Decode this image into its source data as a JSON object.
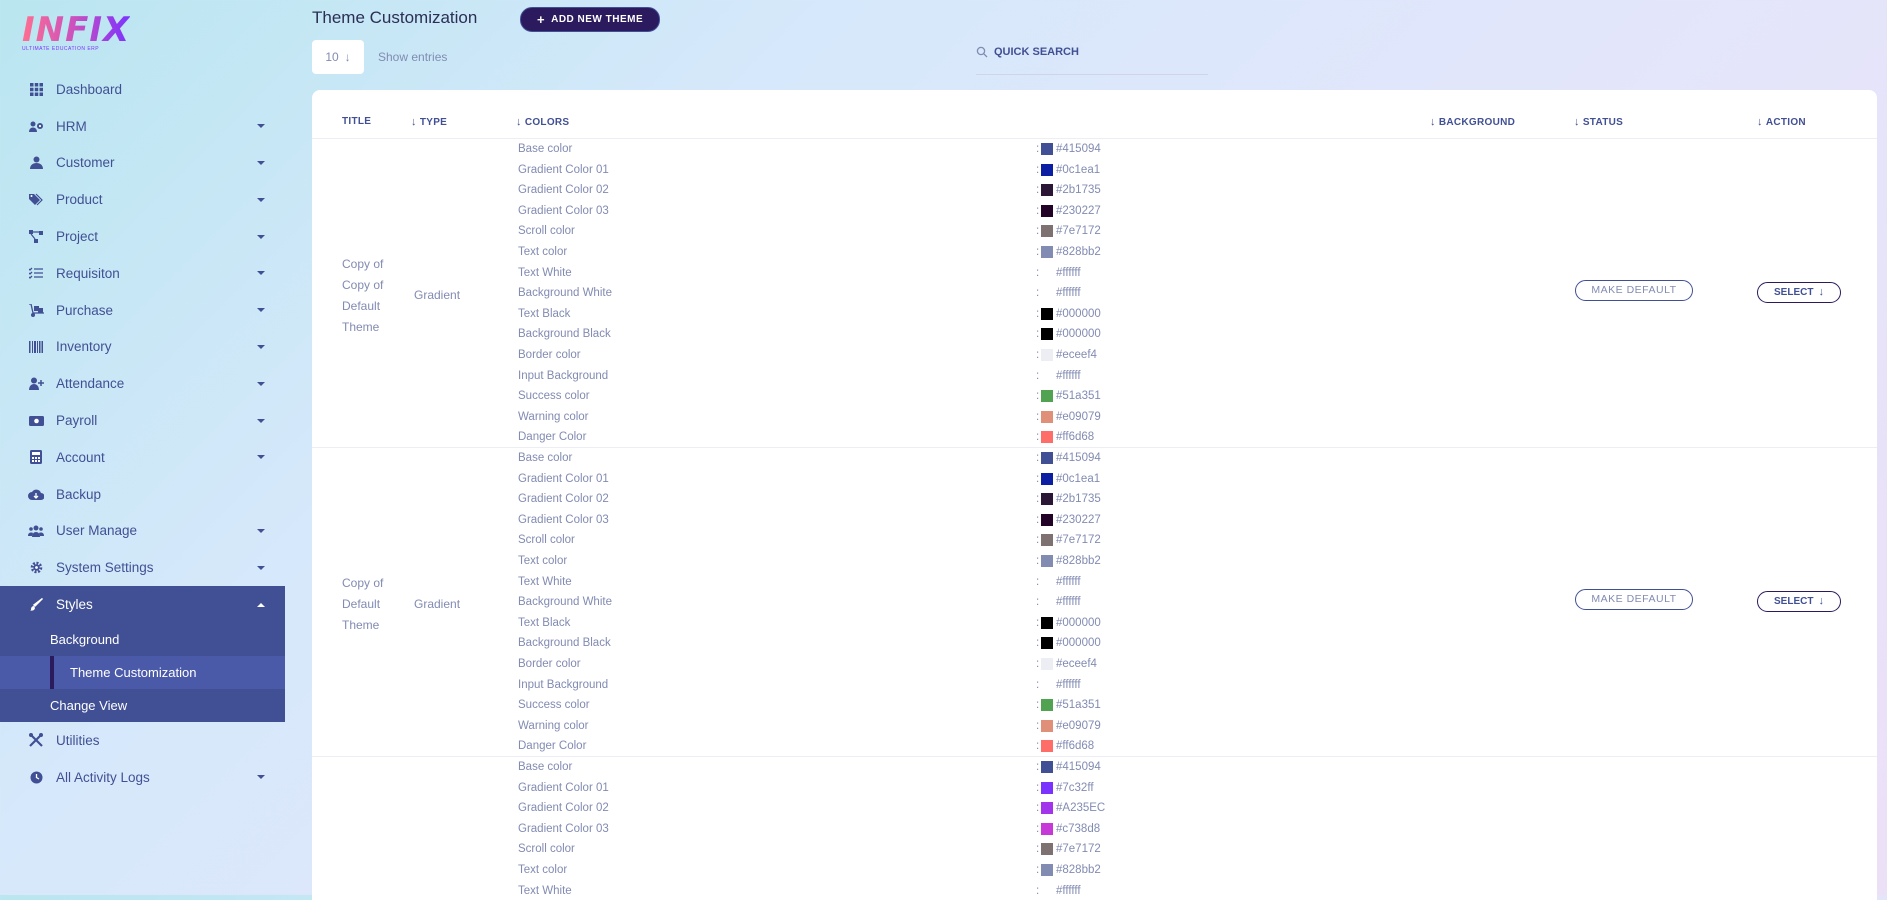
{
  "logo": {
    "text": "INFIX",
    "subtitle": "ULTIMATE EDUCATION ERP"
  },
  "sidebar": {
    "items": [
      {
        "label": "Dashboard",
        "icon": "grid-icon",
        "caret": false
      },
      {
        "label": "HRM",
        "icon": "users-gear-icon",
        "caret": true
      },
      {
        "label": "Customer",
        "icon": "user-icon",
        "caret": true
      },
      {
        "label": "Product",
        "icon": "tags-icon",
        "caret": true
      },
      {
        "label": "Project",
        "icon": "project-diagram-icon",
        "caret": true
      },
      {
        "label": "Requisiton",
        "icon": "list-check-icon",
        "caret": true
      },
      {
        "label": "Purchase",
        "icon": "dolly-icon",
        "caret": true
      },
      {
        "label": "Inventory",
        "icon": "barcode-icon",
        "caret": true
      },
      {
        "label": "Attendance",
        "icon": "user-plus-icon",
        "caret": true
      },
      {
        "label": "Payroll",
        "icon": "money-icon",
        "caret": true
      },
      {
        "label": "Account",
        "icon": "calculator-icon",
        "caret": true
      },
      {
        "label": "Backup",
        "icon": "cloud-download-icon",
        "caret": false
      },
      {
        "label": "User Manage",
        "icon": "users-icon",
        "caret": true
      },
      {
        "label": "System Settings",
        "icon": "gear-icon",
        "caret": true
      }
    ],
    "styles": {
      "label": "Styles",
      "icon": "paint-brush-icon"
    },
    "styles_sub": [
      "Background",
      "Theme Customization",
      "Change View"
    ],
    "after": [
      {
        "label": "Utilities",
        "icon": "tools-icon",
        "caret": false
      },
      {
        "label": "All Activity Logs",
        "icon": "clock-icon",
        "caret": true
      }
    ]
  },
  "header": {
    "title": "Theme Customization",
    "add_button": "ADD NEW THEME",
    "entries_value": "10",
    "entries_label": "Show entries",
    "search_placeholder": "QUICK SEARCH"
  },
  "table": {
    "columns": [
      "TITLE",
      "TYPE",
      "COLORS",
      "BACKGROUND",
      "STATUS",
      "ACTION"
    ],
    "make_default": "MAKE DEFAULT",
    "select": "SELECT",
    "rows": [
      {
        "title_lines": [
          "Copy of",
          "Copy of",
          "Default",
          "Theme"
        ],
        "type": "Gradient",
        "colors": [
          {
            "name": "Base color",
            "hex": "#415094",
            "swatch": "#415094"
          },
          {
            "name": "Gradient Color 01",
            "hex": "#0c1ea1",
            "swatch": "#0c1ea1"
          },
          {
            "name": "Gradient Color 02",
            "hex": "#2b1735",
            "swatch": "#2b1735"
          },
          {
            "name": "Gradient Color 03",
            "hex": "#230227",
            "swatch": "#230227"
          },
          {
            "name": "Scroll color",
            "hex": "#7e7172",
            "swatch": "#7e7172"
          },
          {
            "name": "Text color",
            "hex": "#828bb2",
            "swatch": "#828bb2"
          },
          {
            "name": "Text White",
            "hex": "#ffffff",
            "swatch": "#ffffff"
          },
          {
            "name": "Background White",
            "hex": "#ffffff",
            "swatch": "#ffffff"
          },
          {
            "name": "Text Black",
            "hex": "#000000",
            "swatch": "#000000"
          },
          {
            "name": "Background Black",
            "hex": "#000000",
            "swatch": "#000000"
          },
          {
            "name": "Border color",
            "hex": "#eceef4",
            "swatch": "#eceef4"
          },
          {
            "name": "Input Background",
            "hex": "#ffffff",
            "swatch": "#ffffff"
          },
          {
            "name": "Success color",
            "hex": "#51a351",
            "swatch": "#51a351"
          },
          {
            "name": "Warning color",
            "hex": "#e09079",
            "swatch": "#e09079"
          },
          {
            "name": "Danger Color",
            "hex": "#ff6d68",
            "swatch": "#ff6d68"
          }
        ]
      },
      {
        "title_lines": [
          "Copy of",
          "Default",
          "Theme"
        ],
        "type": "Gradient",
        "colors": [
          {
            "name": "Base color",
            "hex": "#415094",
            "swatch": "#415094"
          },
          {
            "name": "Gradient Color 01",
            "hex": "#0c1ea1",
            "swatch": "#0c1ea1"
          },
          {
            "name": "Gradient Color 02",
            "hex": "#2b1735",
            "swatch": "#2b1735"
          },
          {
            "name": "Gradient Color 03",
            "hex": "#230227",
            "swatch": "#230227"
          },
          {
            "name": "Scroll color",
            "hex": "#7e7172",
            "swatch": "#7e7172"
          },
          {
            "name": "Text color",
            "hex": "#828bb2",
            "swatch": "#828bb2"
          },
          {
            "name": "Text White",
            "hex": "#ffffff",
            "swatch": "#ffffff"
          },
          {
            "name": "Background White",
            "hex": "#ffffff",
            "swatch": "#ffffff"
          },
          {
            "name": "Text Black",
            "hex": "#000000",
            "swatch": "#000000"
          },
          {
            "name": "Background Black",
            "hex": "#000000",
            "swatch": "#000000"
          },
          {
            "name": "Border color",
            "hex": "#eceef4",
            "swatch": "#eceef4"
          },
          {
            "name": "Input Background",
            "hex": "#ffffff",
            "swatch": "#ffffff"
          },
          {
            "name": "Success color",
            "hex": "#51a351",
            "swatch": "#51a351"
          },
          {
            "name": "Warning color",
            "hex": "#e09079",
            "swatch": "#e09079"
          },
          {
            "name": "Danger Color",
            "hex": "#ff6d68",
            "swatch": "#ff6d68"
          }
        ]
      },
      {
        "title_lines": [],
        "type": "",
        "colors": [
          {
            "name": "Base color",
            "hex": "#415094",
            "swatch": "#415094"
          },
          {
            "name": "Gradient Color 01",
            "hex": "#7c32ff",
            "swatch": "#7c32ff"
          },
          {
            "name": "Gradient Color 02",
            "hex": "#A235EC",
            "swatch": "#A235EC"
          },
          {
            "name": "Gradient Color 03",
            "hex": "#c738d8",
            "swatch": "#c738d8"
          },
          {
            "name": "Scroll color",
            "hex": "#7e7172",
            "swatch": "#7e7172"
          },
          {
            "name": "Text color",
            "hex": "#828bb2",
            "swatch": "#828bb2"
          },
          {
            "name": "Text White",
            "hex": "#ffffff",
            "swatch": "#ffffff"
          }
        ]
      }
    ]
  }
}
